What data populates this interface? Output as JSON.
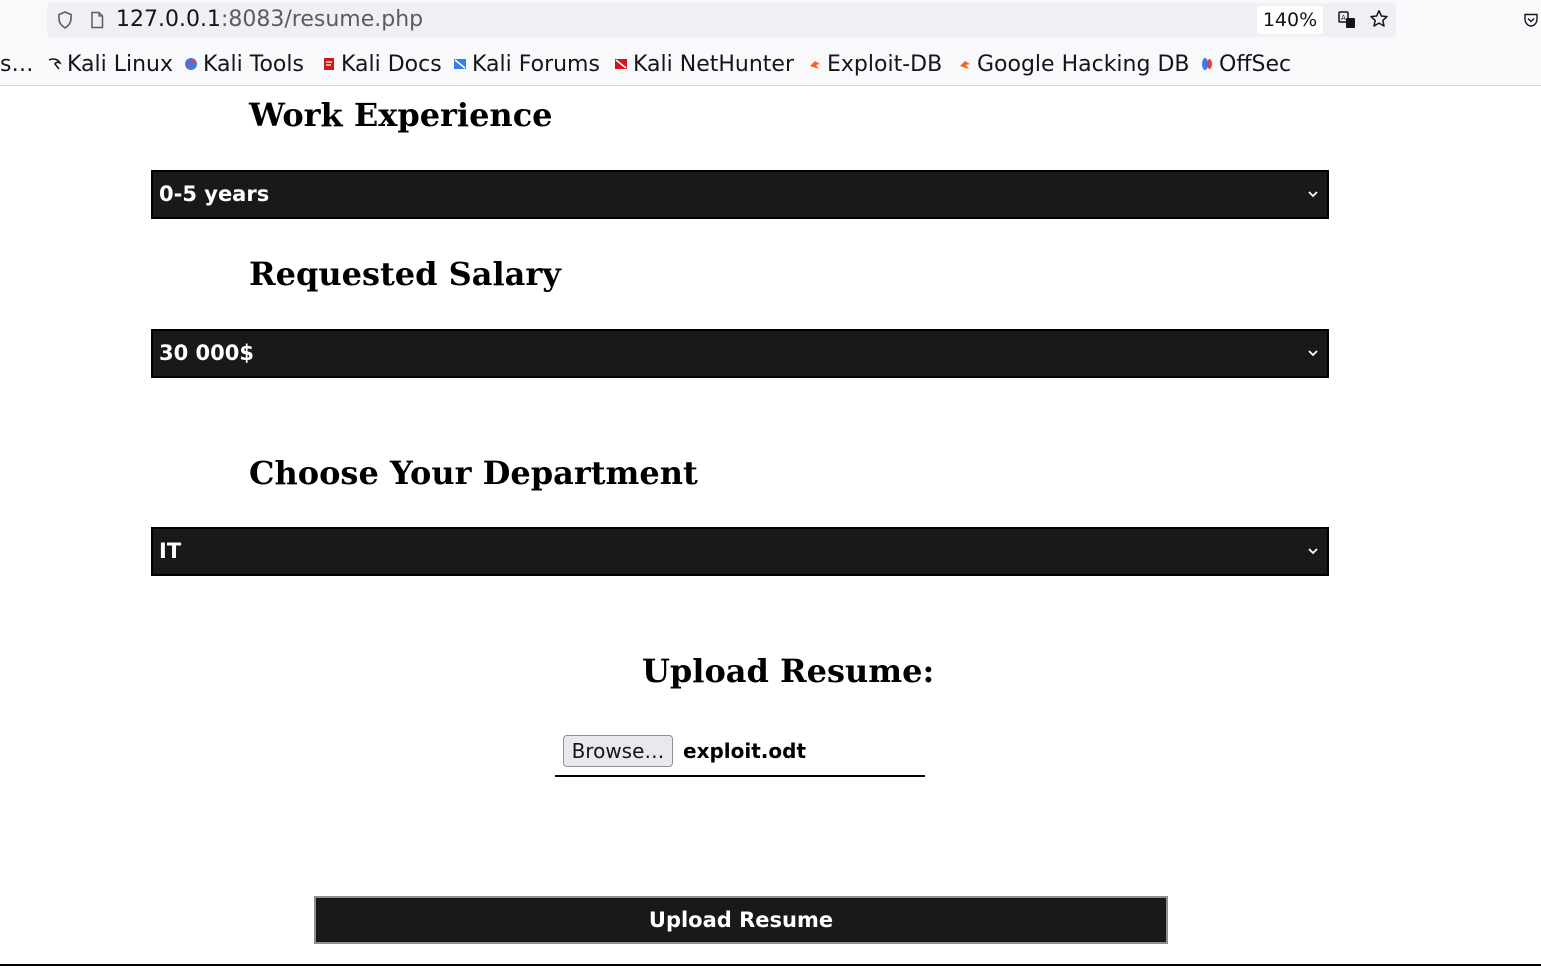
{
  "browser": {
    "url_host": "127.0.0.1",
    "url_rest": ":8083/resume.php",
    "zoom": "140%",
    "bookmarks": [
      {
        "label": "s…",
        "icon": "none"
      },
      {
        "label": "Kali Linux",
        "icon": "kali-dragon-icon"
      },
      {
        "label": "Kali Tools",
        "icon": "kali-tools-icon"
      },
      {
        "label": "Kali Docs",
        "icon": "kali-docs-icon"
      },
      {
        "label": "Kali Forums",
        "icon": "kali-forums-icon"
      },
      {
        "label": "Kali NetHunter",
        "icon": "kali-nethunter-icon"
      },
      {
        "label": "Exploit-DB",
        "icon": "exploit-db-icon"
      },
      {
        "label": "Google Hacking DB",
        "icon": "ghdb-icon"
      },
      {
        "label": "OffSec",
        "icon": "offsec-icon"
      }
    ]
  },
  "form": {
    "experience": {
      "heading": "Work Experience",
      "selected": "0-5 years"
    },
    "salary": {
      "heading": "Requested Salary",
      "selected": "30 000$"
    },
    "department": {
      "heading": "Choose Your Department",
      "selected": "IT"
    },
    "upload": {
      "heading": "Upload Resume:",
      "browse_label": "Browse…",
      "file_name": "exploit.odt"
    },
    "submit_label": "Upload Resume"
  },
  "colors": {
    "select_bg": "#181a18",
    "select_text": "#ffffff",
    "page_bg": "#ffffff"
  }
}
